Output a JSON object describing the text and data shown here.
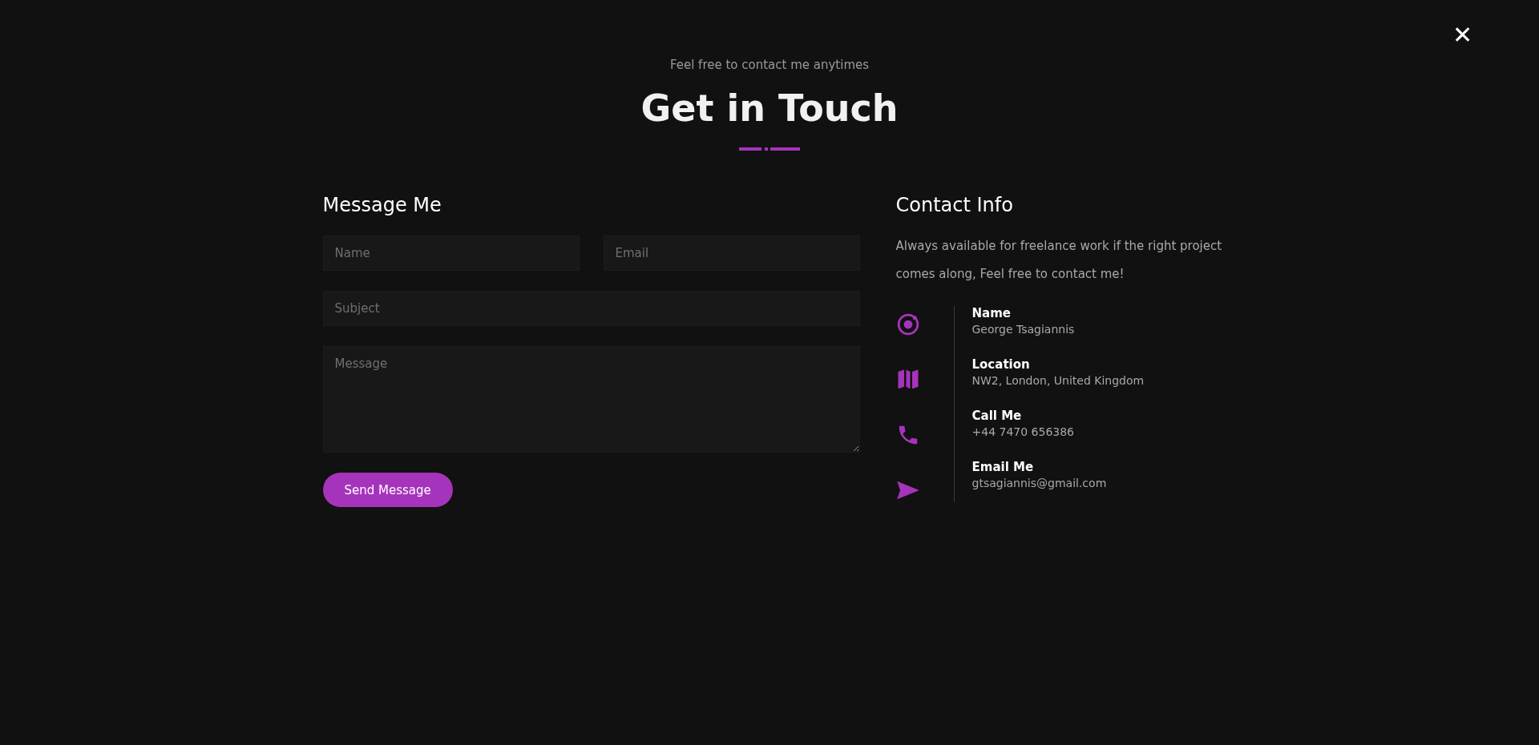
{
  "close_button": {
    "label": "✕"
  },
  "header": {
    "subtitle": "Feel free to contact me anytimes",
    "title": "Get in Touch"
  },
  "message_form": {
    "heading": "Message Me",
    "fields": [
      {
        "placeholder": "Name",
        "kind": "input"
      },
      {
        "placeholder": "Email",
        "kind": "input"
      },
      {
        "placeholder": "Subject",
        "kind": "input"
      },
      {
        "placeholder": "Message",
        "kind": "textarea"
      }
    ],
    "submit_button": "Send Message"
  },
  "contact_info": {
    "heading": "Contact Info",
    "description": "Always available for freelance work if the right project comes along, Feel free to contact me!",
    "items": [
      {
        "kind": "person",
        "label": "Name",
        "value": "George Tsagiannis"
      },
      {
        "kind": "location",
        "label": "Location",
        "value": "NW2, London, United Kingdom"
      },
      {
        "kind": "phone",
        "label": "Call Me",
        "value": "+44 7470 656386"
      },
      {
        "kind": "email",
        "label": "Email Me",
        "value": "gtsagiannis@gmail.com"
      }
    ]
  }
}
